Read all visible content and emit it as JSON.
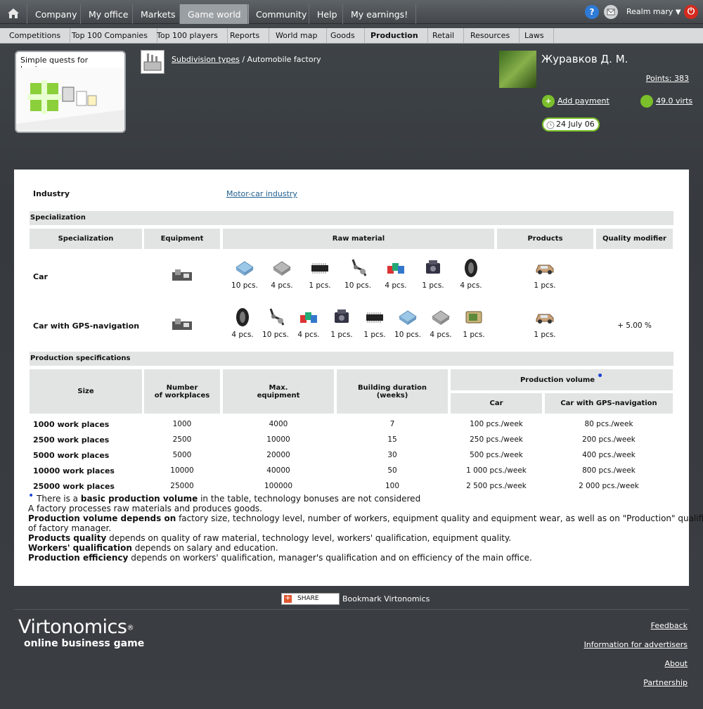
{
  "topnav": {
    "items": [
      "Company",
      "My office",
      "Markets",
      "Game world",
      "Community",
      "Help",
      "My earnings!"
    ],
    "realm": "Realm mary"
  },
  "subnav": {
    "items": [
      "Competitions",
      "Top 100 Companies",
      "Top 100 players",
      "Reports",
      "World map",
      "Goods",
      "Production",
      "Retail",
      "Resources",
      "Laws"
    ]
  },
  "quest": {
    "title": "Simple quests for beginners"
  },
  "breadcrumb": {
    "link": "Subdivision types",
    "current": "/ Automobile factory"
  },
  "user": {
    "name": "Журавков Д. М.",
    "points": "Points: 383",
    "add_payment": "Add payment",
    "virts": "49.0 virts",
    "date": "24 July 06"
  },
  "industry": {
    "label": "Industry",
    "value": "Motor-car industry"
  },
  "specialization": {
    "section": "Specialization",
    "headers": [
      "Specialization",
      "Equipment",
      "Raw material",
      "Products",
      "Quality modifier"
    ],
    "rows": [
      {
        "name": "Car",
        "materials": [
          "10 pcs.",
          "4 pcs.",
          "1 pcs.",
          "10 pcs.",
          "4 pcs.",
          "1 pcs.",
          "4 pcs."
        ],
        "product": "1 pcs.",
        "modifier": ""
      },
      {
        "name": "Car with GPS-navigation",
        "materials": [
          "4 pcs.",
          "10 pcs.",
          "4 pcs.",
          "1 pcs.",
          "1 pcs.",
          "10 pcs.",
          "4 pcs.",
          "1 pcs."
        ],
        "product": "1 pcs.",
        "modifier": "+ 5.00 %"
      }
    ]
  },
  "production": {
    "section": "Production specifications",
    "headers": {
      "size": "Size",
      "workplaces": "Number\nof workplaces",
      "equipment": "Max.\nequipment",
      "duration": "Building duration\n(weeks)",
      "volume": "Production volume",
      "car": "Car",
      "gps": "Car with GPS-navigation"
    },
    "rows": [
      [
        "1000 work places",
        "1000",
        "4000",
        "7",
        "100 pcs./week",
        "80 pcs./week"
      ],
      [
        "2500 work places",
        "2500",
        "10000",
        "15",
        "250 pcs./week",
        "200 pcs./week"
      ],
      [
        "5000 work places",
        "5000",
        "20000",
        "30",
        "500 pcs./week",
        "400 pcs./week"
      ],
      [
        "10000 work places",
        "10000",
        "40000",
        "50",
        "1 000 pcs./week",
        "800 pcs./week"
      ],
      [
        "25000 work places",
        "25000",
        "100000",
        "100",
        "2 500 pcs./week",
        "2 000 pcs./week"
      ]
    ]
  },
  "notes": {
    "n1a": "There is a ",
    "n1b": "basic production volume",
    "n1c": " in the table, technology bonuses are not considered",
    "n2": "A factory processes raw materials and produces goods.",
    "n3b": "Production volume depends on",
    "n3": " factory size, technology level, number of workers, equipment quality and equipment wear, as well as on \"Production\" qualification",
    "n3c": "of factory manager.",
    "n4b": "Products quality",
    "n4": " depends on quality of raw material, technology level, workers' qualification, equipment quality.",
    "n5b": "Workers' qualification",
    "n5": " depends on salary and education.",
    "n6b": "Production efficiency",
    "n6": " depends on workers' qualification, manager's qualification and on efficiency of the main office."
  },
  "footer": {
    "share": "SHARE",
    "bookmark": "Bookmark Virtonomics",
    "logo_big": "Virtonomics",
    "logo_reg": "®",
    "logo_small": "online business game",
    "links": [
      "Feedback",
      "Information for advertisers",
      "About",
      "Partnership"
    ]
  }
}
